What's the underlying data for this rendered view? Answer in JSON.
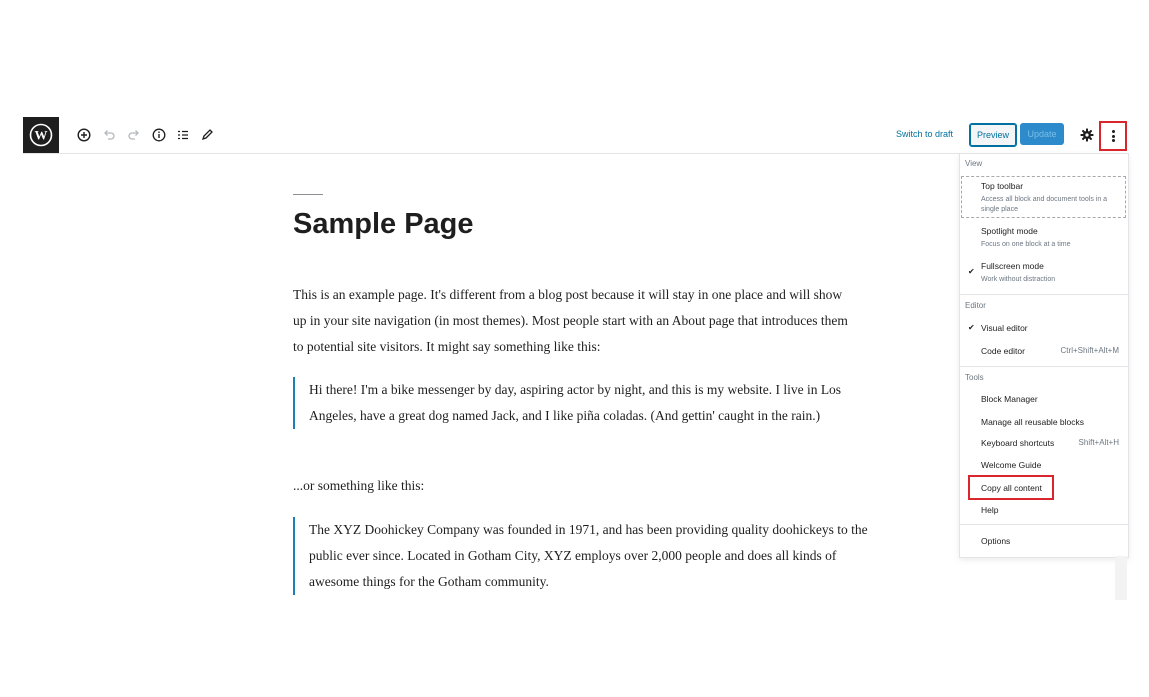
{
  "toolbar": {
    "icons": [
      "wordpress-logo",
      "add-block-icon",
      "undo-icon",
      "redo-icon",
      "info-icon",
      "list-view-icon",
      "edit-icon"
    ],
    "switch_to_draft": "Switch to draft",
    "preview": "Preview",
    "update": "Update",
    "colors": {
      "accent": "#0071a1",
      "update_bg": "#2d8bcb",
      "highlight": "#d9262d"
    }
  },
  "editor": {
    "title": "Sample Page",
    "paragraph1": "This is an example page. It's different from a blog post because it will stay in one place and will show up in your site navigation (in most themes). Most people start with an About page that introduces them to potential site visitors. It might say something like this:",
    "quote1": "Hi there! I'm a bike messenger by day, aspiring actor by night, and this is my website. I live in Los Angeles, have a great dog named Jack, and I like piña coladas. (And gettin' caught in the rain.)",
    "paragraph2": "...or something like this:",
    "quote2": "The XYZ Doohickey Company was founded in 1971, and has been providing quality doohickeys to the public ever since. Located in Gotham City, XYZ employs over 2,000 people and does all kinds of awesome things for the Gotham community."
  },
  "menu": {
    "view_heading": "View",
    "top_toolbar": "Top toolbar",
    "top_toolbar_desc": "Access all block and document tools in a single place",
    "spotlight": "Spotlight mode",
    "spotlight_desc": "Focus on one block at a time",
    "fullscreen": "Fullscreen mode",
    "fullscreen_desc": "Work without distraction",
    "fullscreen_checked": true,
    "editor_heading": "Editor",
    "visual_editor": "Visual editor",
    "visual_checked": true,
    "code_editor": "Code editor",
    "code_shortcut": "Ctrl+Shift+Alt+M",
    "tools_heading": "Tools",
    "block_manager": "Block Manager",
    "manage_reusable": "Manage all reusable blocks",
    "keyboard_shortcuts": "Keyboard shortcuts",
    "keyboard_shortcut": "Shift+Alt+H",
    "welcome_guide": "Welcome Guide",
    "copy_all": "Copy all content",
    "help": "Help",
    "options": "Options"
  }
}
